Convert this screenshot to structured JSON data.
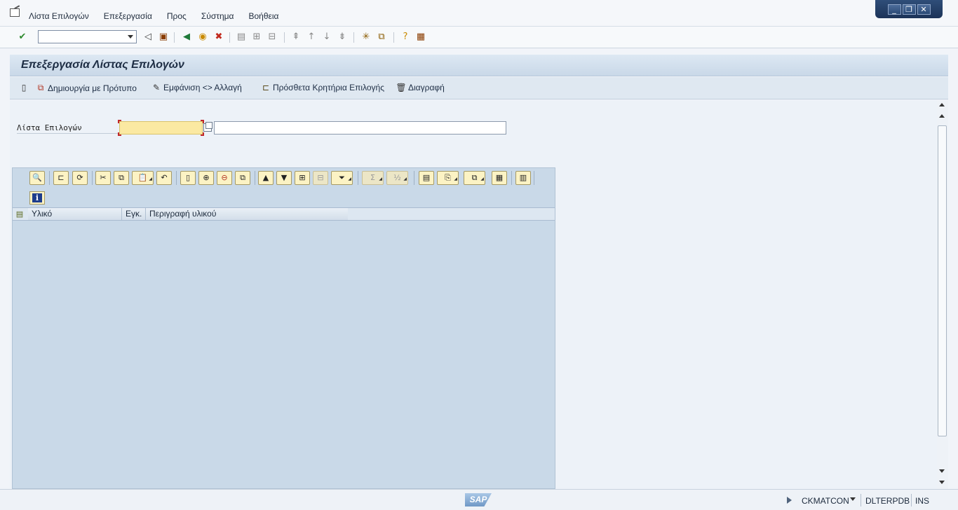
{
  "menu": {
    "items": [
      "Λίστα Επιλογών",
      "Επεξεργασία",
      "Προς",
      "Σύστημα",
      "Βοήθεια"
    ]
  },
  "window_controls": {
    "minimize": "_",
    "restore": "❐",
    "close": "✕"
  },
  "toolbar": {
    "command_value": ""
  },
  "title": {
    "text": "Επεξεργασία Λίστας Επιλογών"
  },
  "app_toolbar": {
    "create_with_template": "Δημιουργία με Πρότυπο",
    "display_change": "Εμφάνιση <> Αλλαγή",
    "additional_criteria": "Πρόσθετα Κρητήρια Επιλογής",
    "delete": "Διαγραφή"
  },
  "form": {
    "selection_list_label": "Λίστα Επιλογών",
    "selection_list_value": "",
    "description_value": ""
  },
  "grid": {
    "info_glyph": "i",
    "columns": [
      "Υλικό",
      "Εγκ.",
      "Περιγραφή υλικού"
    ],
    "rows": []
  },
  "status": {
    "logo": "SAP",
    "transaction": "CKMATCON",
    "server": "DLTERPDB",
    "mode": "INS"
  },
  "colors": {
    "accent_title": "#1d2d44",
    "input_required": "#fbe9a2",
    "grid_background": "#c9d9e8",
    "toolbar_button": "#fcf3c4"
  }
}
